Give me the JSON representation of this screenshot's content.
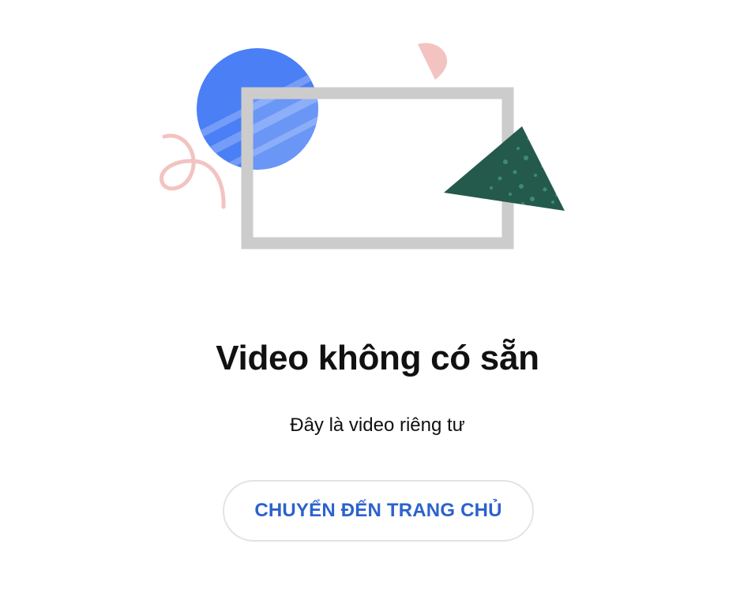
{
  "error": {
    "title": "Video không có sẵn",
    "message": "Đây là video riêng tư"
  },
  "actions": {
    "home_button_label": "CHUYỂN ĐẾN TRANG CHỦ"
  },
  "colors": {
    "accent": "#2c62cc",
    "title_text": "#111111",
    "button_border": "#e3e3e3",
    "circle_blue": "#4a7ff5",
    "circle_stripe": "#7da2f8",
    "frame_gray": "#cccccc",
    "triangle_green": "#235a4c",
    "triangle_speckle": "#3f8a72",
    "squiggle_pink": "#f3c3c1"
  },
  "illustration": {
    "icons": [
      "blue-circle-shape",
      "pink-semicircle-shape",
      "video-frame-icon",
      "green-triangle-shape",
      "pink-squiggle-shape"
    ]
  }
}
